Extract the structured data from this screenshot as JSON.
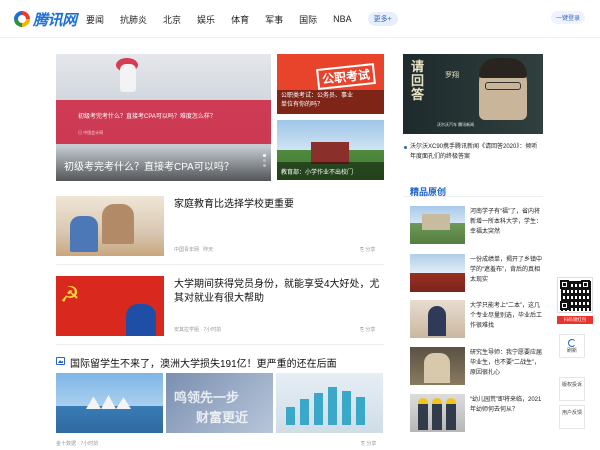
{
  "header": {
    "logo_text": "腾讯网",
    "nav": [
      "要闻",
      "抗肺炎",
      "北京",
      "娱乐",
      "体育",
      "军事",
      "国际",
      "NBA"
    ],
    "more_label": "更多+",
    "login_label": "一键登录"
  },
  "hero": {
    "title": "初级考完考什么？直接考CPA可以吗？",
    "overlay_text": "初级考完考什么？直接考CPA可以吗？难度怎么样？",
    "overlay_sub": "日  中国会计网"
  },
  "thumbs": [
    {
      "title": "公职类考试：公务员、事业单位有你的吗？",
      "badge": "公职考试"
    },
    {
      "title": "教育部：小学作业不出校门"
    }
  ],
  "news": [
    {
      "title": "家庭教育比选择学校更重要",
      "source": "中国青年网",
      "time": "昨天",
      "share": "分享"
    },
    {
      "title": "大学期间获得党员身份，就能享受4大好处，尤其对就业有很大帮助",
      "source": "安其拉学姐",
      "time": "7小时前",
      "share": "分享"
    }
  ],
  "article3": {
    "title": "国际留学生不来了，澳洲大学损失191亿！更严重的还在后面",
    "img2_line1": "鸣领先一步",
    "img2_line2": "财富更近",
    "source": "金十数据",
    "time": "7小时前",
    "share": "分享"
  },
  "ad": {
    "calligraphy": "请回答",
    "person": "罗翔",
    "footer": "沃尔沃汽车  腾讯新闻",
    "text": "沃尔沃XC90携手腾讯新闻《请回答2020》：倾听年度面孔们的终极答案"
  },
  "featured": {
    "heading": "精品原创",
    "items": [
      {
        "text": "河南学子有“福”了，省内将新增一所本科大学，学生：幸福太突然"
      },
      {
        "text": "一份成绩单，揭开了乡镇中学的“遮羞布”，背后的真相太现实"
      },
      {
        "text": "大学只能考上“二本”，这几个专业尽量别选，毕业后工作很难找"
      },
      {
        "text": "研究生导师：我宁愿要应届毕业生，也不要“二战生”，原因很扎心"
      },
      {
        "text": "“幼儿园荒”即将来临，2021年幼师何去何从？"
      }
    ]
  },
  "side": {
    "qr_label": "扫码领红包",
    "refresh_label": "刷新",
    "copyright_label": "版权投诉",
    "feedback_label": "用户反馈"
  }
}
